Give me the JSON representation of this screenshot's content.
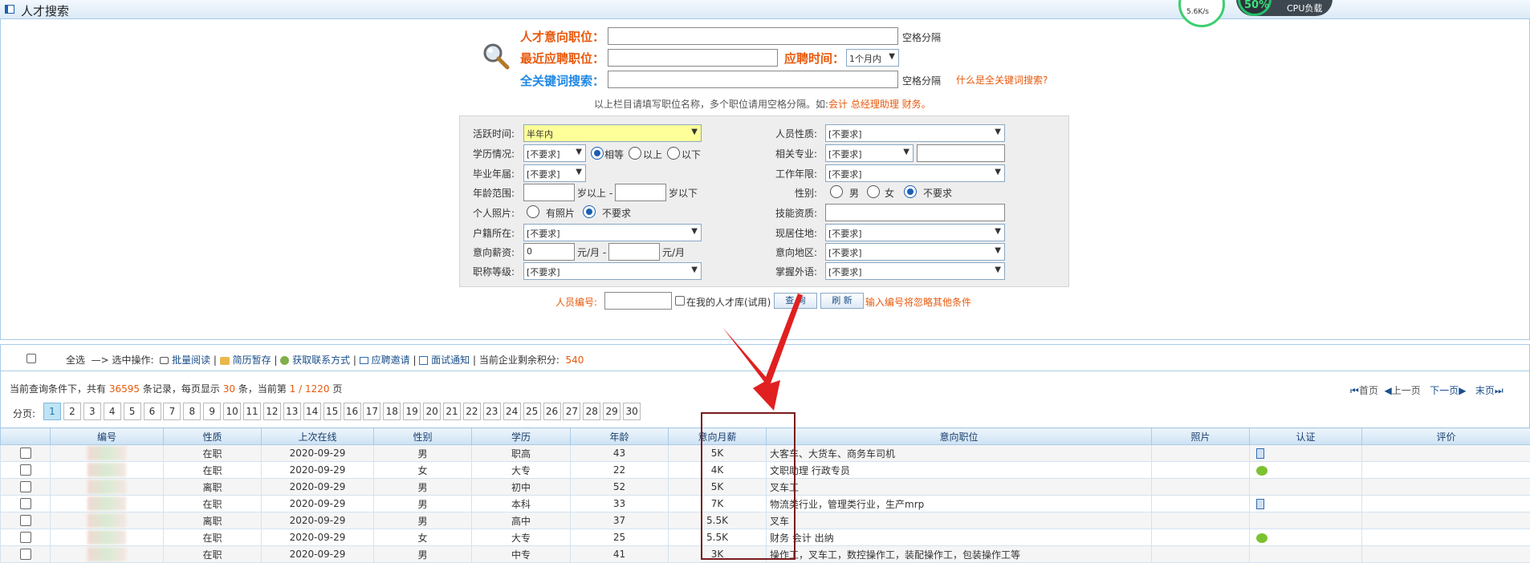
{
  "window": {
    "title": "人才搜索"
  },
  "netmon": {
    "speed": "5.6K/s",
    "cpu_percent": "50%",
    "cpu_label": "CPU负载"
  },
  "search": {
    "job_intent_label": "人才意向职位：",
    "recent_job_label": "最近应聘职位：",
    "apply_time_label": "应聘时间：",
    "apply_time_value": "1个月内",
    "keyword_label": "全关键词搜索：",
    "space_sep_1": "空格分隔",
    "space_sep_2": "空格分隔",
    "keyword_help": "什么是全关键词搜索?",
    "hint_prefix": "以上栏目请填写职位名称，多个职位请用空格分隔。如:",
    "hint_example": "会计 总经理助理 财务。"
  },
  "filters": {
    "active_time_label": "活跃时间:",
    "active_time_value": "半年内",
    "nature_label": "人员性质:",
    "nature_value": "[不要求]",
    "education_label": "学历情况:",
    "education_value": "[不要求]",
    "edu_equal": "相等",
    "edu_above": "以上",
    "edu_below": "以下",
    "major_label": "相关专业:",
    "major_value": "[不要求]",
    "grad_year_label": "毕业年届:",
    "grad_year_value": "[不要求]",
    "work_years_label": "工作年限:",
    "work_years_value": "[不要求]",
    "age_label": "年龄范围:",
    "age_above": "岁以上 -",
    "age_below": "岁以下",
    "gender_label": "性别:",
    "gender_male": "男",
    "gender_female": "女",
    "gender_any": "不要求",
    "photo_label": "个人照片:",
    "photo_has": "有照片",
    "photo_any": "不要求",
    "skill_label": "技能资质:",
    "hukou_label": "户籍所在:",
    "hukou_value": "[不要求]",
    "residence_label": "现居住地:",
    "residence_value": "[不要求]",
    "salary_label": "意向薪资:",
    "salary_from": "0",
    "salary_unit_1": "元/月 -",
    "salary_unit_2": "元/月",
    "region_label": "意向地区:",
    "region_value": "[不要求]",
    "title_level_label": "职称等级:",
    "title_level_value": "[不要求]",
    "language_label": "掌握外语:",
    "language_value": "[不要求]",
    "person_id_label": "人员编号:",
    "in_my_library": "在我的人才库(试用)",
    "query_btn": "查 询",
    "refresh_btn": "刷 新",
    "id_note": "输入编号将忽略其他条件"
  },
  "toolbar": {
    "select_all": "全选",
    "arrow_text": "—>",
    "selected_ops": "选中操作:",
    "batch_read": "批量阅读",
    "temp_save": "简历暂存",
    "get_contact": "获取联系方式",
    "invite": "应聘邀请",
    "interview": "面试通知",
    "credits_label": "当前企业剩余积分:",
    "credits_value": "540"
  },
  "summary": {
    "p1": "当前查询条件下，共有",
    "total": "36595",
    "p2": "条记录，每页显示",
    "per_page": "30",
    "p3": "条，当前第",
    "page": "1 / 1220",
    "p4": "页"
  },
  "pager": {
    "label": "分页:",
    "pages": [
      "1",
      "2",
      "3",
      "4",
      "5",
      "6",
      "7",
      "8",
      "9",
      "10",
      "11",
      "12",
      "13",
      "14",
      "15",
      "16",
      "17",
      "18",
      "19",
      "20",
      "21",
      "22",
      "23",
      "24",
      "25",
      "26",
      "27",
      "28",
      "29",
      "30"
    ],
    "first": "首页",
    "prev": "上一页",
    "next": "下一页",
    "last": "末页"
  },
  "table": {
    "headers": [
      "",
      "编号",
      "性质",
      "上次在线",
      "性别",
      "学历",
      "年龄",
      "意向月薪",
      "意向职位",
      "照片",
      "认证",
      "评价"
    ],
    "rows": [
      {
        "status": "在职",
        "date": "2020-09-29",
        "gender": "男",
        "edu": "职高",
        "age": "43",
        "salary": "5K",
        "job": "大客车、大货车、商务车司机",
        "cert": "doc"
      },
      {
        "status": "在职",
        "date": "2020-09-29",
        "gender": "女",
        "edu": "大专",
        "age": "22",
        "salary": "4K",
        "job": "文职助理 行政专员",
        "cert": "chat"
      },
      {
        "status": "离职",
        "date": "2020-09-29",
        "gender": "男",
        "edu": "初中",
        "age": "52",
        "salary": "5K",
        "job": "叉车工",
        "cert": ""
      },
      {
        "status": "在职",
        "date": "2020-09-29",
        "gender": "男",
        "edu": "本科",
        "age": "33",
        "salary": "7K",
        "job": "物流类行业，管理类行业，生产mrp",
        "cert": "doc"
      },
      {
        "status": "离职",
        "date": "2020-09-29",
        "gender": "男",
        "edu": "高中",
        "age": "37",
        "salary": "5.5K",
        "job": "叉车",
        "cert": ""
      },
      {
        "status": "在职",
        "date": "2020-09-29",
        "gender": "女",
        "edu": "大专",
        "age": "25",
        "salary": "5.5K",
        "job": "财务 会计 出纳",
        "cert": "chat"
      },
      {
        "status": "在职",
        "date": "2020-09-29",
        "gender": "男",
        "edu": "中专",
        "age": "41",
        "salary": "3K",
        "job": "操作工，叉车工，数控操作工，装配操作工，包装操作工等",
        "cert": ""
      }
    ]
  }
}
